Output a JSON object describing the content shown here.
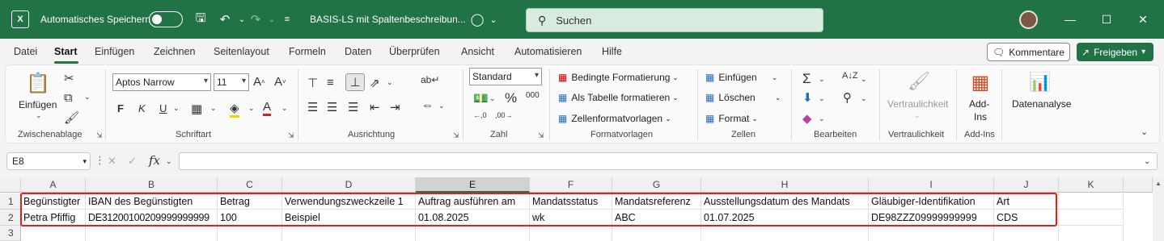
{
  "titlebar": {
    "app_icon": "excel-icon",
    "autosave_label": "Automatisches Speichern",
    "doc_title": "BASIS-LS mit Spaltenbeschreibun...",
    "search_placeholder": "Suchen"
  },
  "menu": {
    "tabs": [
      "Datei",
      "Start",
      "Einfügen",
      "Zeichnen",
      "Seitenlayout",
      "Formeln",
      "Daten",
      "Überprüfen",
      "Ansicht",
      "Automatisieren",
      "Hilfe"
    ],
    "active": "Start",
    "comment_label": "Kommentare",
    "share_label": "Freigeben"
  },
  "ribbon": {
    "clipboard": {
      "paste_label": "Einfügen",
      "group_label": "Zwischenablage"
    },
    "font": {
      "name": "Aptos Narrow",
      "size": "11",
      "bold": "F",
      "italic": "K",
      "underline": "U",
      "group_label": "Schriftart"
    },
    "alignment": {
      "group_label": "Ausrichtung"
    },
    "number": {
      "format": "Standard",
      "group_label": "Zahl"
    },
    "styles": {
      "conditional": "Bedingte Formatierung",
      "as_table": "Als Tabelle formatieren",
      "cell_styles": "Zellenformatvorlagen",
      "group_label": "Formatvorlagen"
    },
    "cells": {
      "insert": "Einfügen",
      "delete": "Löschen",
      "format": "Format",
      "group_label": "Zellen"
    },
    "editing": {
      "group_label": "Bearbeiten"
    },
    "sensitivity": {
      "button_label": "Vertraulichkeit",
      "group_label": "Vertraulichkeit"
    },
    "addins": {
      "button_label_1": "Add-",
      "button_label_2": "Ins",
      "group_label": "Add-Ins"
    },
    "analysis": {
      "button_label": "Datenanalyse"
    }
  },
  "formula_bar": {
    "name_box": "E8",
    "fx": "fx",
    "value": ""
  },
  "sheet": {
    "columns": [
      "A",
      "B",
      "C",
      "D",
      "E",
      "F",
      "G",
      "H",
      "I",
      "J",
      "K"
    ],
    "selected_column": "E",
    "rows": [
      {
        "num": "1",
        "cells": [
          "Begünstigter",
          "IBAN des Begünstigten",
          "Betrag",
          "Verwendungszweckzeile 1",
          "Auftrag ausführen am",
          "Mandatsstatus",
          "Mandatsreferenz",
          "Ausstellungsdatum des Mandats",
          "Gläubiger-Identifikation",
          "Art",
          ""
        ]
      },
      {
        "num": "2",
        "cells": [
          "Petra Pfiffig",
          "DE31200100209999999999",
          "100",
          "Beispiel",
          "01.08.2025",
          "wk",
          "ABC",
          "01.07.2025",
          "DE98ZZZ09999999999",
          "CDS",
          ""
        ]
      },
      {
        "num": "3",
        "cells": [
          "",
          "",
          "",
          "",
          "",
          "",
          "",
          "",
          "",
          "",
          ""
        ]
      }
    ]
  }
}
